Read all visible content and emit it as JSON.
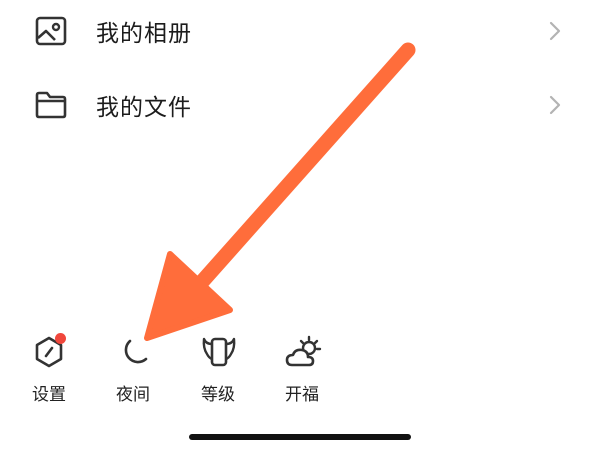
{
  "menu": {
    "items": [
      {
        "label": "我的相册",
        "icon": "photo-album-icon"
      },
      {
        "label": "我的文件",
        "icon": "folder-icon"
      }
    ]
  },
  "quick_actions": [
    {
      "label": "设置",
      "icon": "settings-hexagon-icon",
      "has_badge": true
    },
    {
      "label": "夜间",
      "icon": "moon-icon"
    },
    {
      "label": "等级",
      "icon": "level-badge-icon"
    },
    {
      "label": "开福",
      "icon": "sun-cloud-icon"
    }
  ],
  "colors": {
    "annotation_arrow": "#ff6d3b",
    "badge": "#f0473c",
    "icon_stroke": "#333333",
    "chevron": "#b3b3b3"
  }
}
